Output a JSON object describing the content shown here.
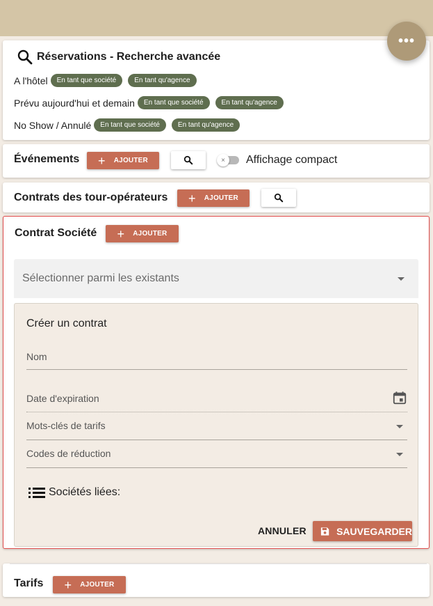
{
  "fab": {
    "label": "•••"
  },
  "search": {
    "title": "Réservations - Recherche avancée",
    "rows": [
      {
        "label": "A l'hôtel",
        "chip_company": "En tant que société",
        "chip_agency": "En tant qu'agence"
      },
      {
        "label": "Prévu aujourd'hui et demain",
        "chip_company": "En tant que société",
        "chip_agency": "En tant qu'agence"
      },
      {
        "label": "No Show / Annulé",
        "chip_company": "En tant que société",
        "chip_agency": "En tant qu'agence"
      }
    ]
  },
  "events": {
    "title": "Événements",
    "add_label": "AJOUTER",
    "toggle_label": "Affichage compact"
  },
  "tour": {
    "title": "Contrats des tour-opérateurs",
    "add_label": "AJOUTER"
  },
  "contract": {
    "title": "Contrat Société",
    "add_label": "AJOUTER",
    "select_placeholder": "Sélectionner parmi les existants",
    "create_title": "Créer un contrat",
    "fields": {
      "name": "Nom",
      "expiration": "Date d'expiration",
      "rate_keywords": "Mots-clés de tarifs",
      "discount_codes": "Codes de réduction"
    },
    "linked_companies": "Sociétés liées:",
    "cancel_label": "ANNULER",
    "save_label": "SAUVEGARDER"
  },
  "tarifs": {
    "title": "Tarifs",
    "add_label": "AJOUTER"
  },
  "colors": {
    "accent": "#c66d55",
    "chip": "#5f6e4f",
    "topbar": "#d4c5a6",
    "fab": "#ae9a78",
    "highlight_border": "#e14d4d"
  },
  "icons": [
    "more-icon",
    "search-icon",
    "plus-icon",
    "close-icon",
    "calendar-icon",
    "dropdown-arrow-icon",
    "list-icon",
    "save-icon"
  ]
}
